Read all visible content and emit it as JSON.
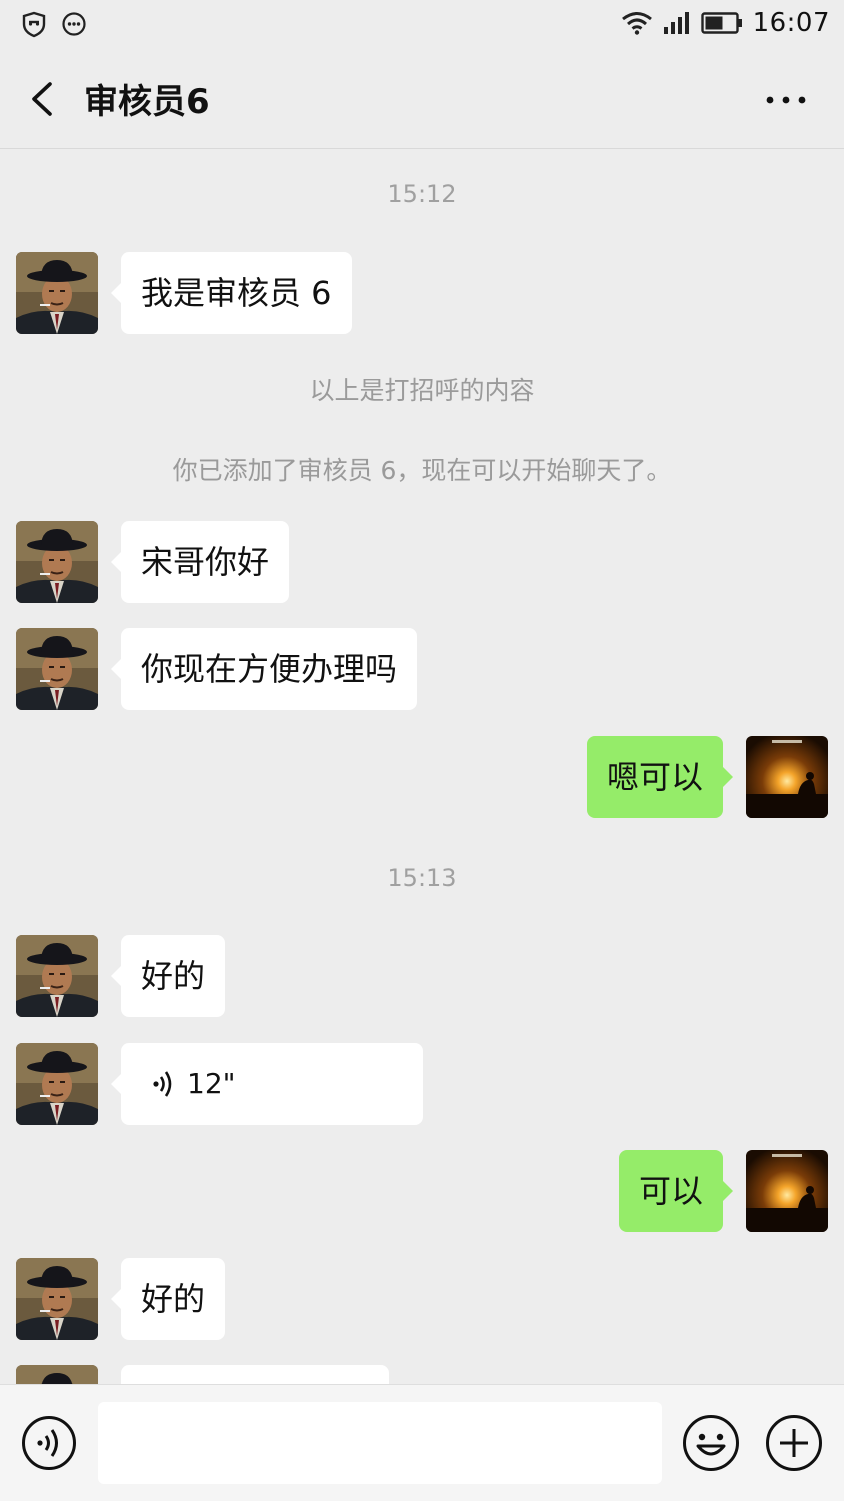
{
  "status_bar": {
    "time": "16:07",
    "icons": [
      "shield-icon",
      "chat-dots-icon",
      "wifi-icon",
      "signal-icon",
      "battery-icon"
    ]
  },
  "header": {
    "title": "审核员6",
    "back_icon": "chevron-left-icon",
    "more_icon": "more-dots-icon"
  },
  "chat": {
    "timestamp_1": "15:12",
    "msg_1": "我是审核员 6",
    "notice_greeting": "以上是打招呼的内容",
    "notice_added": "你已添加了审核员 6，现在可以开始聊天了。",
    "msg_2": "宋哥你好",
    "msg_3": "你现在方便办理吗",
    "msg_4_me": "嗯可以",
    "timestamp_2": "15:13",
    "msg_5": "好的",
    "voice_duration": "12\"",
    "msg_7_me": "可以",
    "msg_8": "好的"
  },
  "bottom_bar": {
    "voice_icon": "voice-input-icon",
    "emoji_icon": "emoji-icon",
    "plus_icon": "plus-icon",
    "input_value": ""
  },
  "colors": {
    "background": "#ededed",
    "my_bubble": "#95ec69",
    "their_bubble": "#ffffff"
  }
}
